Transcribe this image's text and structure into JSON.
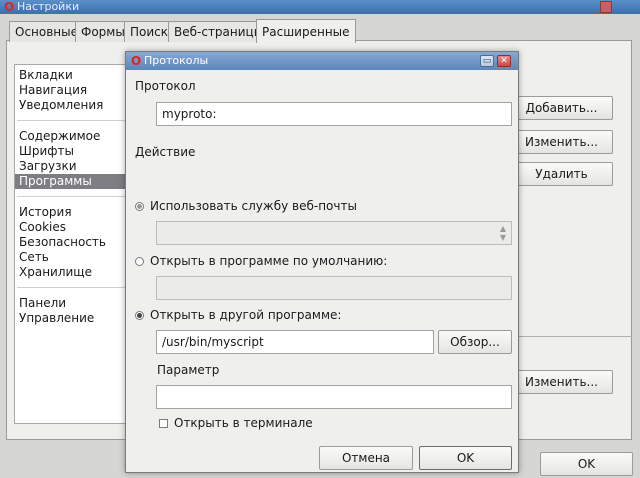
{
  "background": {
    "window_title": "Настройки",
    "tabs": [
      {
        "label": "Основные"
      },
      {
        "label": "Формы"
      },
      {
        "label": "Поиск"
      },
      {
        "label": "Веб-страницы"
      },
      {
        "label": "Расширенные"
      }
    ],
    "active_tab": "Расширенные",
    "sidebar": {
      "items": [
        {
          "label": "Вкладки"
        },
        {
          "label": "Навигация"
        },
        {
          "label": "Уведомления"
        },
        {
          "label": "Содержимое"
        },
        {
          "label": "Шрифты"
        },
        {
          "label": "Загрузки"
        },
        {
          "label": "Программы"
        },
        {
          "label": "История"
        },
        {
          "label": "Cookies"
        },
        {
          "label": "Безопасность"
        },
        {
          "label": "Сеть"
        },
        {
          "label": "Хранилище"
        },
        {
          "label": "Панели"
        },
        {
          "label": "Управление"
        }
      ],
      "selected": "Программы"
    },
    "buttons": {
      "add": "Добавить...",
      "edit": "Изменить...",
      "delete": "Удалить",
      "edit2": "Изменить...",
      "ok": "OK"
    }
  },
  "dialog": {
    "title": "Протоколы",
    "protocol_label": "Протокол",
    "protocol_value": "myproto:",
    "action_label": "Действие",
    "options": {
      "webmail": "Использовать службу веб-почты",
      "default_app": "Открыть в программе по умолчанию:",
      "other_app": "Открыть в другой программе:"
    },
    "selected_option": "other_app",
    "program_path": "/usr/bin/myscript",
    "browse_button": "Обзор...",
    "param_label": "Параметр",
    "param_value": "",
    "terminal_checkbox": "Открыть в терминале",
    "terminal_checked": false,
    "cancel_button": "Отмена",
    "ok_button": "OK"
  },
  "colors": {
    "selection": "#7d7d82",
    "title_bar": "#5f86ba",
    "window_bg": "#efefed",
    "brand_logo": "#e2231a"
  }
}
